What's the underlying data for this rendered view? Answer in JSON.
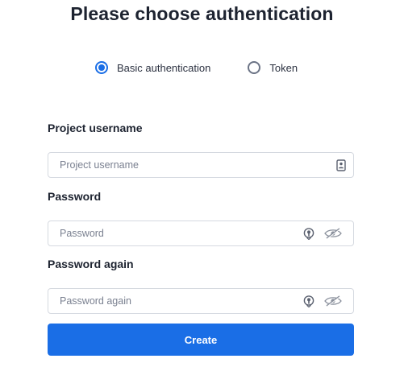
{
  "title": "Please choose authentication",
  "auth_options": [
    {
      "label": "Basic authentication",
      "selected": true
    },
    {
      "label": "Token",
      "selected": false
    }
  ],
  "fields": {
    "username": {
      "label": "Project username",
      "placeholder": "Project username",
      "value": "",
      "icon": "contact-card-icon"
    },
    "password": {
      "label": "Password",
      "placeholder": "Password",
      "value": "",
      "icons": [
        "key-badge-icon",
        "eye-slash-icon"
      ]
    },
    "password_again": {
      "label": "Password again",
      "placeholder": "Password again",
      "value": "",
      "icons": [
        "key-badge-icon",
        "eye-slash-icon"
      ]
    }
  },
  "create_button": {
    "label": "Create"
  },
  "colors": {
    "accent": "#1a6ee6",
    "text": "#1d2330",
    "border": "#d5d9e0"
  }
}
